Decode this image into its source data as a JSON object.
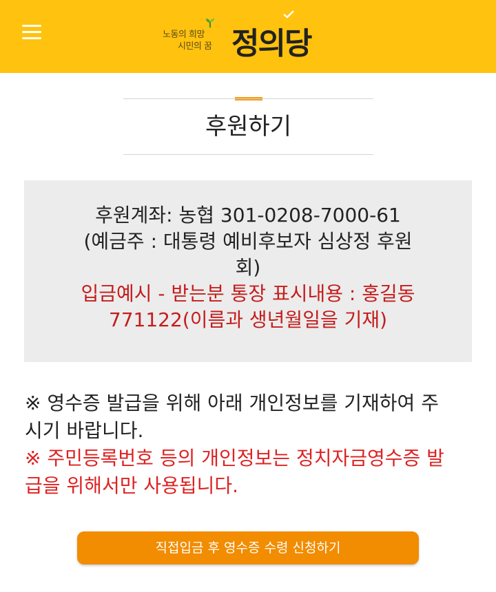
{
  "header": {
    "menu_icon": "hamburger-menu-icon",
    "logo": {
      "slogan_line1": "노동의 희망",
      "slogan_line2": "시민의 꿈",
      "name": "정의당"
    },
    "colors": {
      "background": "#ffc20e"
    }
  },
  "page": {
    "title": "후원하기",
    "accent_color": "#f39c12"
  },
  "account": {
    "line1": "후원계좌: 농협 301-0208-7000-61",
    "line2": "(예금주 : 대통령 예비후보자 심상정 후원",
    "line3": "회)",
    "example_line1": "입금예시 - 받는분 통장 표시내용 : 홍길동",
    "example_line2": "771122(이름과 생년월일을 기재)"
  },
  "notice": {
    "line1": "※ 영수증 발급을 위해 아래 개인정보를 기재하여 주",
    "line2": "시기 바랍니다.",
    "warning_line1": "※ 주민등록번호 등의 개인정보는 정치자금영수증 발",
    "warning_line2": "급을 위해서만 사용됩니다."
  },
  "cta": {
    "label": "직접입금 후 영수증 수령 신청하기",
    "color": "#f28c00"
  }
}
